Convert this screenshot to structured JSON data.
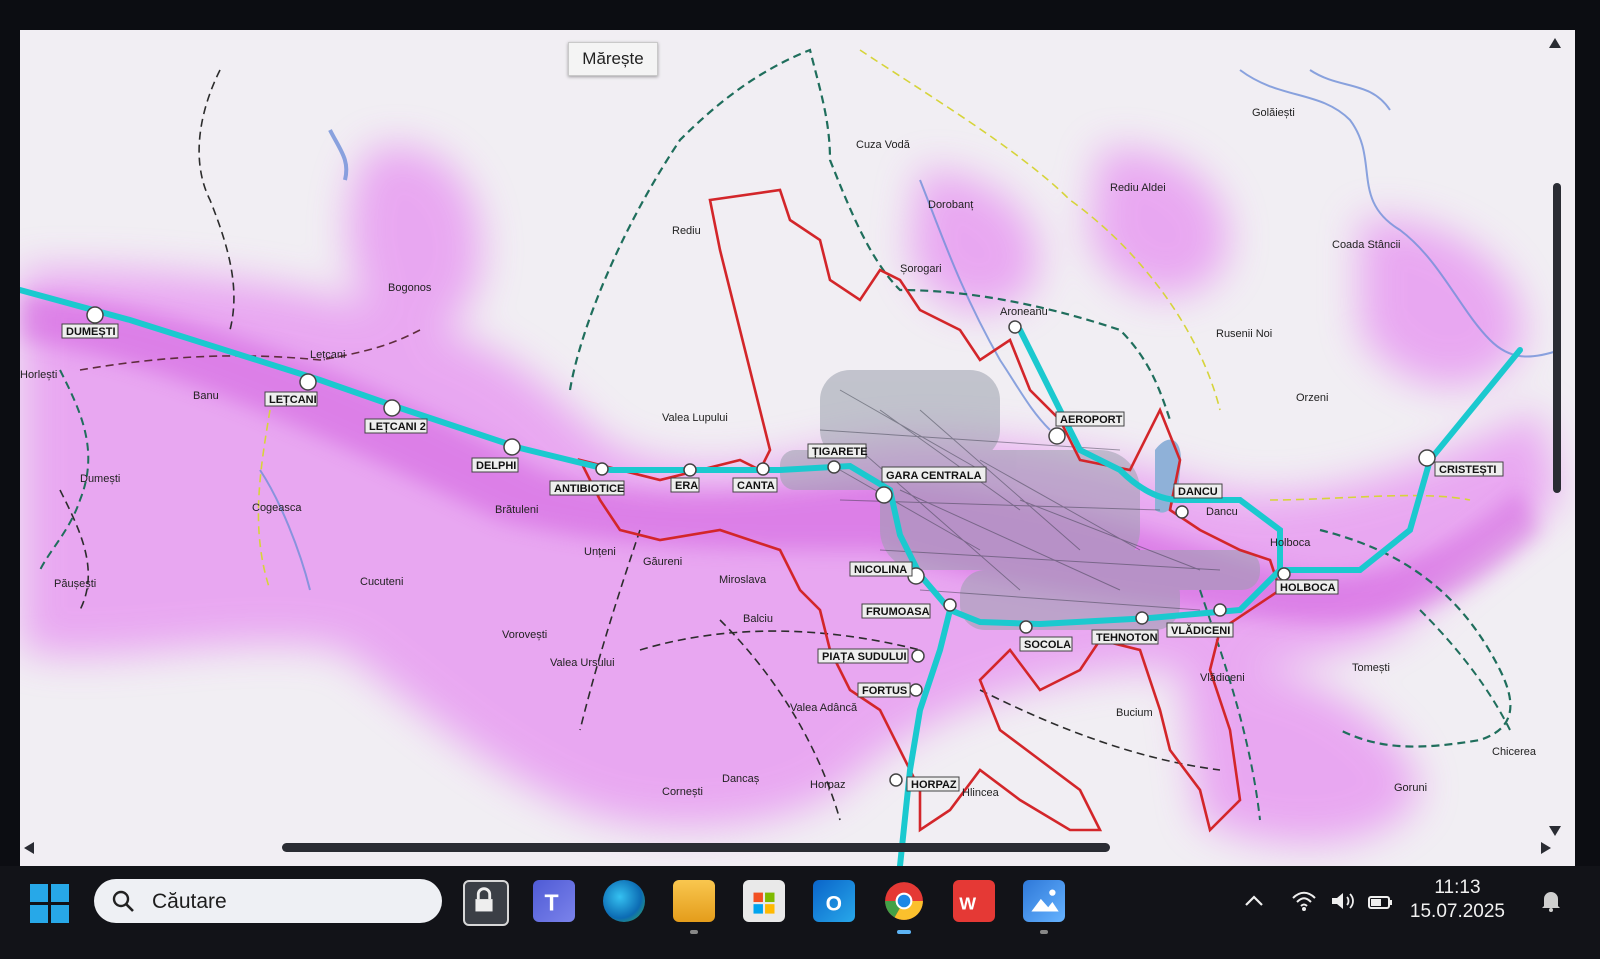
{
  "tooltip": {
    "text": "Mărește"
  },
  "map": {
    "stations": [
      {
        "name": "DUMEȘTI"
      },
      {
        "name": "LEȚCANI"
      },
      {
        "name": "LEȚCANI 2"
      },
      {
        "name": "DELPHI"
      },
      {
        "name": "ANTIBIOTICE"
      },
      {
        "name": "ERA"
      },
      {
        "name": "CANTA"
      },
      {
        "name": "ȚIGARETE"
      },
      {
        "name": "GARA CENTRALA"
      },
      {
        "name": "NICOLINA"
      },
      {
        "name": "FRUMOASA"
      },
      {
        "name": "PIAȚA SUDULUI"
      },
      {
        "name": "FORTUS"
      },
      {
        "name": "HORPAZ"
      },
      {
        "name": "SOCOLA"
      },
      {
        "name": "TEHNOTON"
      },
      {
        "name": "VLĂDICENI"
      },
      {
        "name": "HOLBOCA"
      },
      {
        "name": "DANCU"
      },
      {
        "name": "AEROPORT"
      },
      {
        "name": "CRISTEȘTI"
      }
    ],
    "localities": [
      "Golăiești",
      "Cuza Vodă",
      "Rediu Aldei",
      "Dorobanț",
      "Rediu",
      "Șorogari",
      "Coada Stâncii",
      "Bogonos",
      "Aroneanu",
      "Rusenii Noi",
      "Lețcani",
      "Horlești",
      "Banu",
      "Valea Lupului",
      "Orzeni",
      "Dumești",
      "Cogeasca",
      "Brătuleni",
      "Dancu",
      "Holboca",
      "Unțeni",
      "Găureni",
      "Miroslava",
      "Păușești",
      "Cucuteni",
      "Balciu",
      "Vorovești",
      "Valea Ursului",
      "Tomești",
      "Vlădiceni",
      "Bucium",
      "Valea Adâncă",
      "Chicerea",
      "Dancaș",
      "Horpaz",
      "Cornești",
      "Hlincea",
      "Goruni"
    ]
  },
  "taskbar": {
    "search_placeholder": "Căutare",
    "apps": [
      "lock-app",
      "teams",
      "edge",
      "file-explorer",
      "microsoft-store",
      "outlook",
      "chrome",
      "wps-office",
      "photos"
    ],
    "time": "11:13",
    "date": "15.07.2025"
  },
  "colors": {
    "rail": "#1bc9cf",
    "boundary": "#d8262a",
    "catchment": "#e05fe8",
    "dashed_route": "#1f6e5c"
  }
}
